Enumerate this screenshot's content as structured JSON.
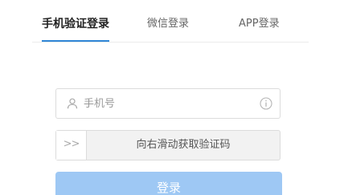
{
  "tabs": [
    {
      "label": "手机验证登录",
      "active": true
    },
    {
      "label": "微信登录",
      "active": false
    },
    {
      "label": "APP登录",
      "active": false
    }
  ],
  "phone": {
    "placeholder": "手机号",
    "value": "",
    "left_icon": "user-icon",
    "right_icon": "info-icon"
  },
  "slider": {
    "handle_glyph": ">>",
    "text": "向右滑动获取验证码"
  },
  "login": {
    "label": "登录"
  },
  "colors": {
    "accent": "#2f86d6",
    "button": "#9ec8f4",
    "slider_bg": "#f2f2f2",
    "border": "#dcdcdc"
  }
}
